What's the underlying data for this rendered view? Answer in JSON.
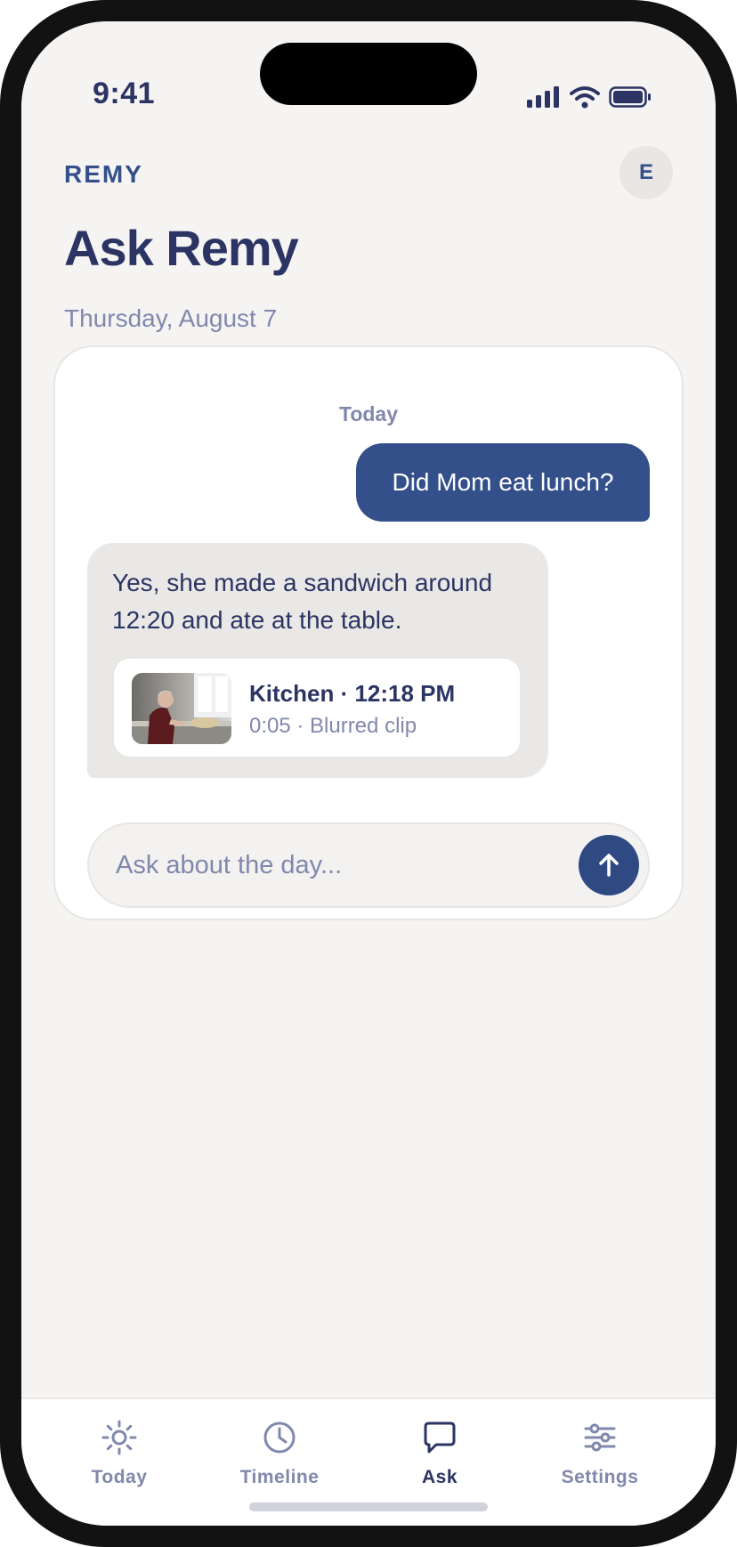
{
  "status_bar": {
    "time": "9:41"
  },
  "header": {
    "brand": "REMY",
    "avatar_initial": "E",
    "title": "Ask Remy",
    "date": "Thursday, August 7"
  },
  "conversation": {
    "day_label": "Today",
    "user_message": "Did Mom eat lunch?",
    "assistant_message": "Yes, she made a sandwich around 12:20 and ate at the table.",
    "clip": {
      "title": "Kitchen · 12:18 PM",
      "meta": "0:05 · Blurred clip"
    }
  },
  "composer": {
    "placeholder": "Ask about the day...",
    "value": ""
  },
  "tabs": [
    {
      "label": "Today",
      "icon": "sun-icon",
      "active": false
    },
    {
      "label": "Timeline",
      "icon": "clock-icon",
      "active": false
    },
    {
      "label": "Ask",
      "icon": "chat-bubble-icon",
      "active": true
    },
    {
      "label": "Settings",
      "icon": "sliders-icon",
      "active": false
    }
  ],
  "colors": {
    "brand_navy": "#2b3463",
    "accent_blue": "#34508a",
    "muted": "#8088ac",
    "background": "#f5f4f3"
  }
}
